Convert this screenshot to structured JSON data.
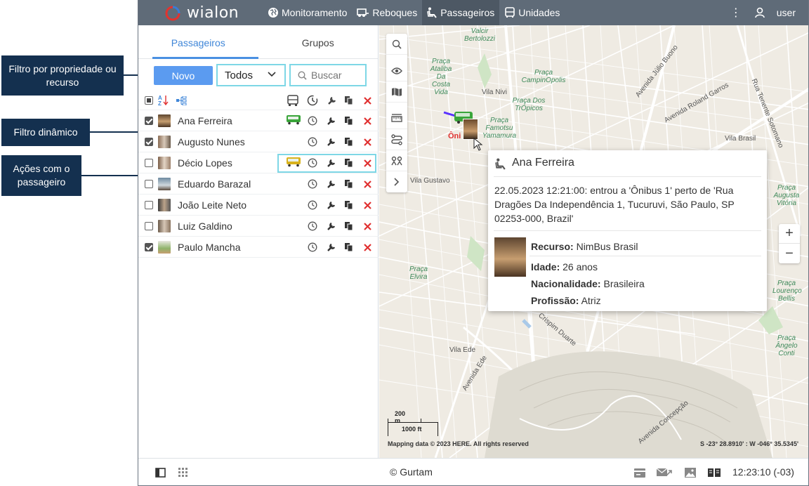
{
  "callouts": {
    "filter_property": "Filtro por propriedade ou recurso",
    "dynamic_filter": "Filtro dinâmico",
    "passenger_actions": "Ações com o passageiro"
  },
  "app": {
    "logo": "wialon",
    "nav": [
      "Monitoramento",
      "Reboques",
      "Passageiros",
      "Unidades"
    ],
    "active_nav": "Passageiros",
    "user": "user"
  },
  "panel": {
    "tabs": [
      "Passageiros",
      "Grupos"
    ],
    "new_button": "Novo",
    "filter_value": "Todos",
    "search_placeholder": "Buscar",
    "passengers": [
      {
        "name": "Ana Ferreira",
        "checked": true,
        "has_unit": true
      },
      {
        "name": "Augusto Nunes",
        "checked": true,
        "has_unit": false
      },
      {
        "name": "Décio Lopes",
        "checked": false,
        "has_unit": true
      },
      {
        "name": "Eduardo Barazal",
        "checked": false,
        "has_unit": false
      },
      {
        "name": "João Leite Neto",
        "checked": false,
        "has_unit": false
      },
      {
        "name": "Luiz Galdino",
        "checked": false,
        "has_unit": false
      },
      {
        "name": "Paulo Mancha",
        "checked": true,
        "has_unit": false
      }
    ]
  },
  "map": {
    "place_labels": [
      "Valcir Bertolozzi",
      "Praça Ataliba Da Costa Vida",
      "Praça CampinOpolis",
      "Praça Dos TrÓpicos",
      "Praça Famotsu Yamamura",
      "Praça Elvira",
      "Praça Augusta Vitória",
      "Praça Lourenço Bellis",
      "Praça Ângelo Conti"
    ],
    "streets": [
      "Vila Nivi",
      "Avenida Júlio Buono",
      "Avenida Roland Garros",
      "Rua Tenente Sotomano",
      "Vila Brasil",
      "Vila Gustavo",
      "Vila Ede",
      "Avenida Ede",
      "Crispim Duarte",
      "Avenida Concepção"
    ],
    "marker_label": "Ôni",
    "scale_m": "200 m",
    "scale_ft": "1000 ft",
    "copyright": "Mapping data © 2023 HERE. All rights reserved",
    "coords": "S -23° 28.8910' : W -046° 35.5345'"
  },
  "popup": {
    "name": "Ana Ferreira",
    "event": "22.05.2023 12:21:00: entrou a 'Ônibus 1' perto de 'Rua Dragões Da Independência 1, Tucuruvi, São Paulo, SP 02253-000, Brazil'",
    "fields": [
      {
        "label": "Recurso:",
        "value": "NimBus Brasil"
      },
      {
        "label": "Idade:",
        "value": "26 anos"
      },
      {
        "label": "Nacionalidade:",
        "value": "Brasileira"
      },
      {
        "label": "Profissão:",
        "value": "Atriz"
      }
    ]
  },
  "bottom": {
    "copyright": "© Gurtam",
    "time": "12:23:10 (-03)"
  },
  "colors": {
    "topbar": "#5f6b78",
    "accent": "#4a90e2",
    "callout": "#14304f",
    "highlight": "#7ed7e6",
    "delete": "#e03030"
  }
}
